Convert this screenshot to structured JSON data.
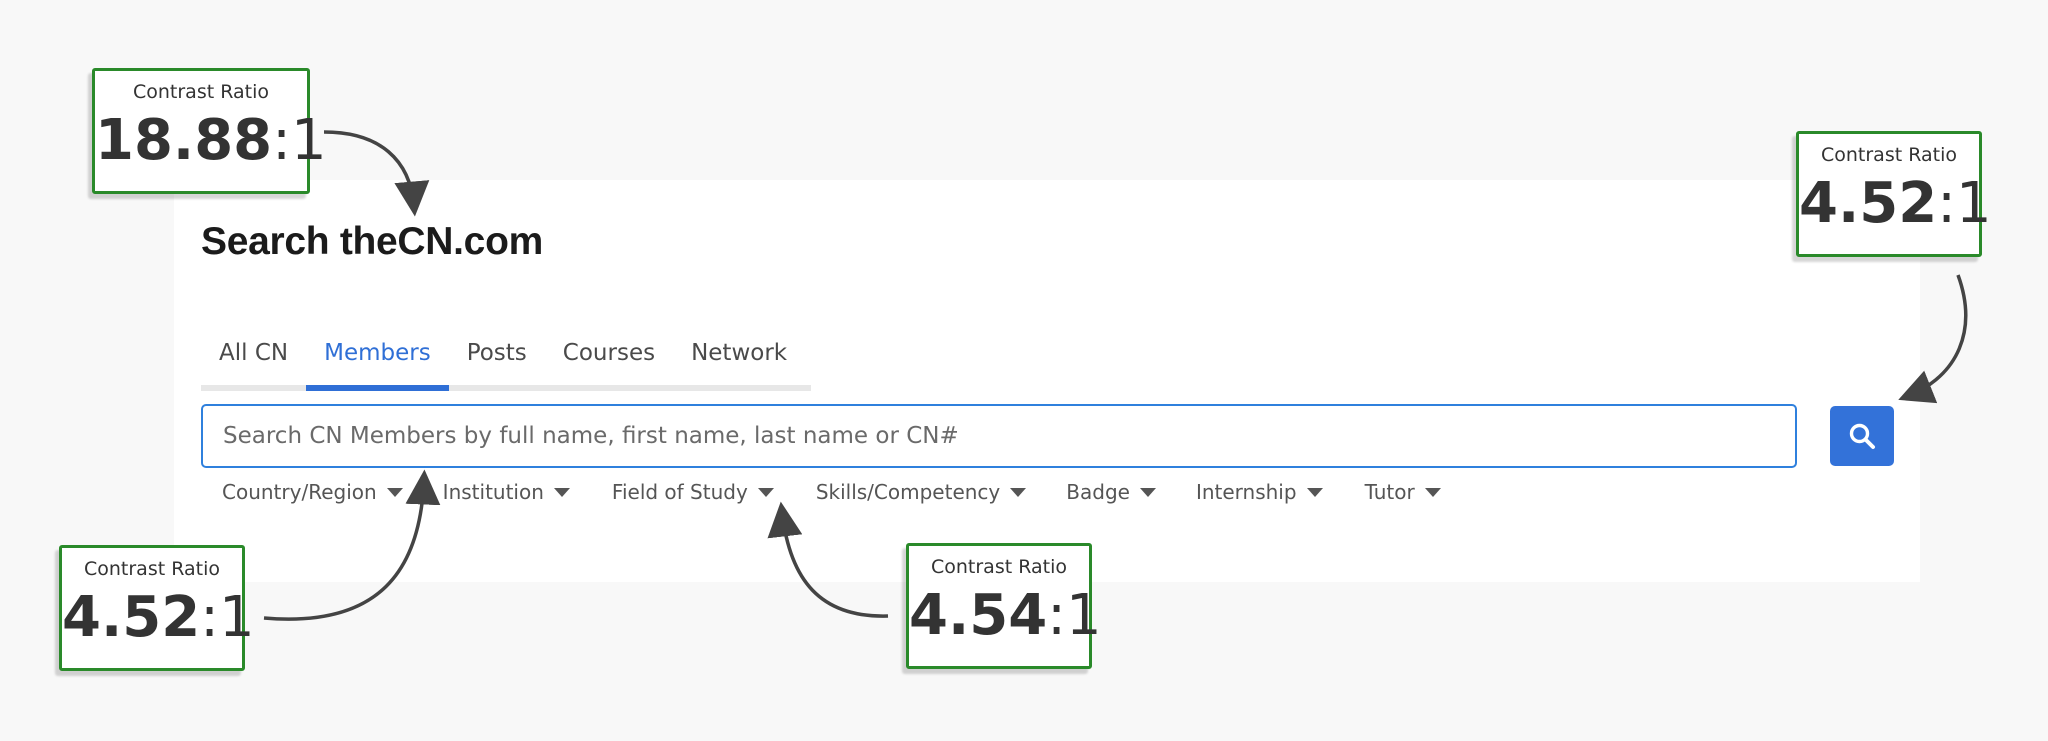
{
  "page": {
    "title": "Search theCN.com"
  },
  "tabs": [
    {
      "label": "All CN",
      "active": false
    },
    {
      "label": "Members",
      "active": true
    },
    {
      "label": "Posts",
      "active": false
    },
    {
      "label": "Courses",
      "active": false
    },
    {
      "label": "Network",
      "active": false
    }
  ],
  "search": {
    "value": "",
    "placeholder": "Search CN Members by full name, first name, last name or CN#",
    "button_icon": "search-icon"
  },
  "filters": [
    {
      "label": "Country/Region",
      "icon": "caret-down-icon"
    },
    {
      "label": "Institution",
      "icon": "caret-down-icon"
    },
    {
      "label": "Field of Study",
      "icon": "caret-down-icon"
    },
    {
      "label": "Skills/Competency",
      "icon": "caret-down-icon"
    },
    {
      "label": "Badge",
      "icon": "caret-down-icon"
    },
    {
      "label": "Internship",
      "icon": "caret-down-icon"
    },
    {
      "label": "Tutor",
      "icon": "caret-down-icon"
    }
  ],
  "annotations": [
    {
      "label": "Contrast Ratio",
      "value": "18.88",
      "suffix": ":1"
    },
    {
      "label": "Contrast Ratio",
      "value": "4.52",
      "suffix": ":1"
    },
    {
      "label": "Contrast Ratio",
      "value": "4.52",
      "suffix": ":1"
    },
    {
      "label": "Contrast Ratio",
      "value": "4.54",
      "suffix": ":1"
    }
  ],
  "colors": {
    "accent": "#2f6fd6",
    "search_button": "#3372d9",
    "badge_border": "#2a8a2a",
    "background": "#f8f8f8",
    "title_text": "#1b1b1b"
  }
}
